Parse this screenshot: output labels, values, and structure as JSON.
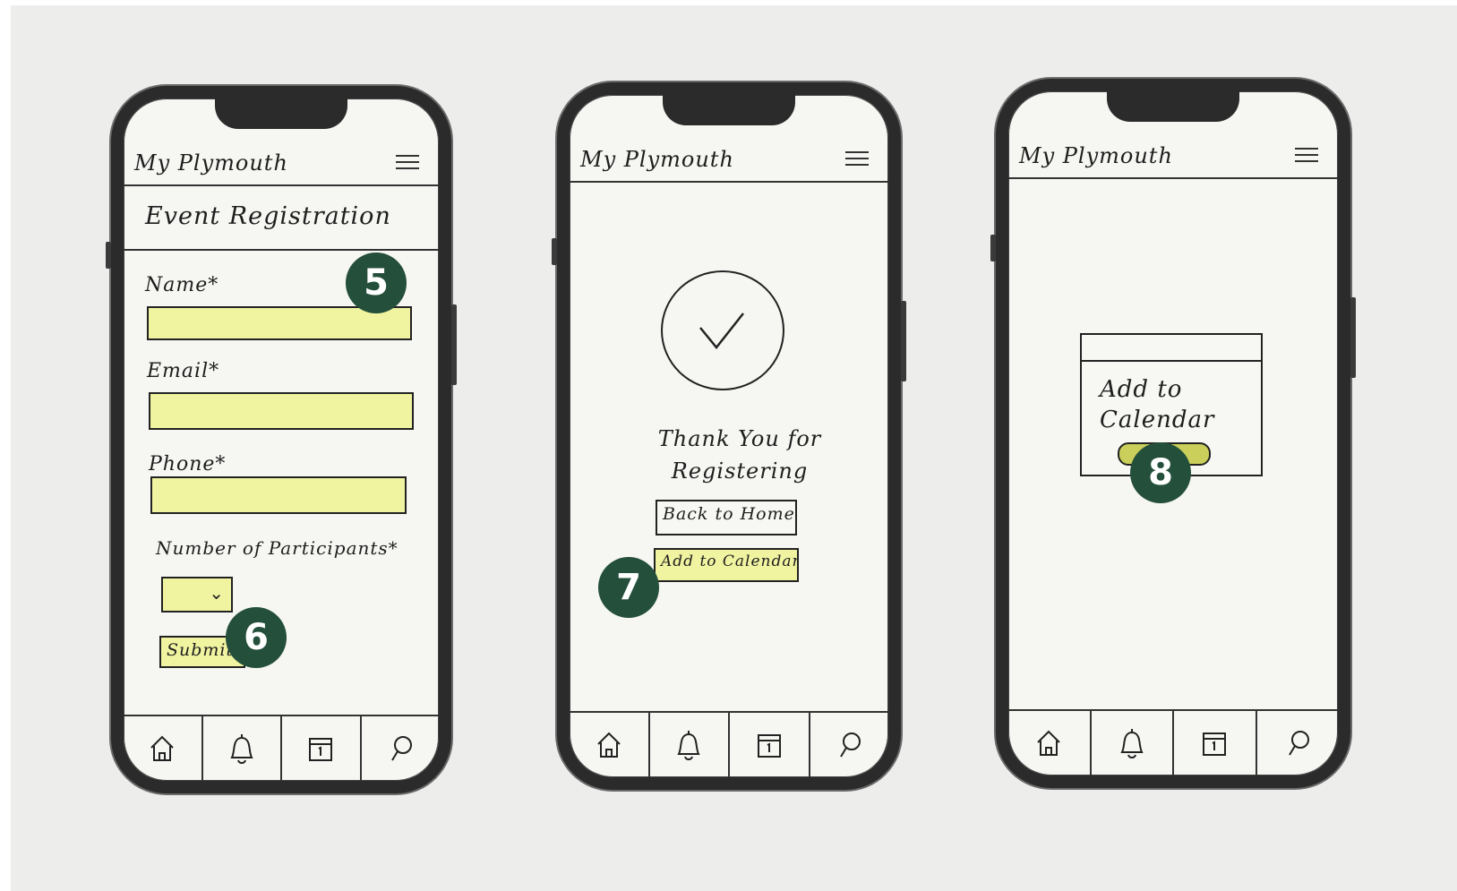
{
  "app": {
    "title": "My Plymouth"
  },
  "screen1": {
    "section_title": "Event Registration",
    "fields": [
      {
        "label": "Name*"
      },
      {
        "label": "Email*"
      },
      {
        "label": "Phone*"
      }
    ],
    "participants_label": "Number of Participants*",
    "participants_value": "",
    "submit_label": "Submit",
    "badges": [
      "5",
      "6"
    ]
  },
  "screen2": {
    "thanks_line1": "Thank You for",
    "thanks_line2": "Registering",
    "back_home_label": "Back to Home",
    "add_calendar_label": "Add to Calendar",
    "badge": "7"
  },
  "screen3": {
    "card_line1": "Add to",
    "card_line2": "Calendar",
    "badge": "8"
  },
  "tabbar": {
    "icons": [
      "home-icon",
      "bell-icon",
      "calendar-icon",
      "search-icon"
    ]
  },
  "colors": {
    "highlight": "#f0f4a0",
    "badge": "#244f3b",
    "ink": "#222222"
  }
}
